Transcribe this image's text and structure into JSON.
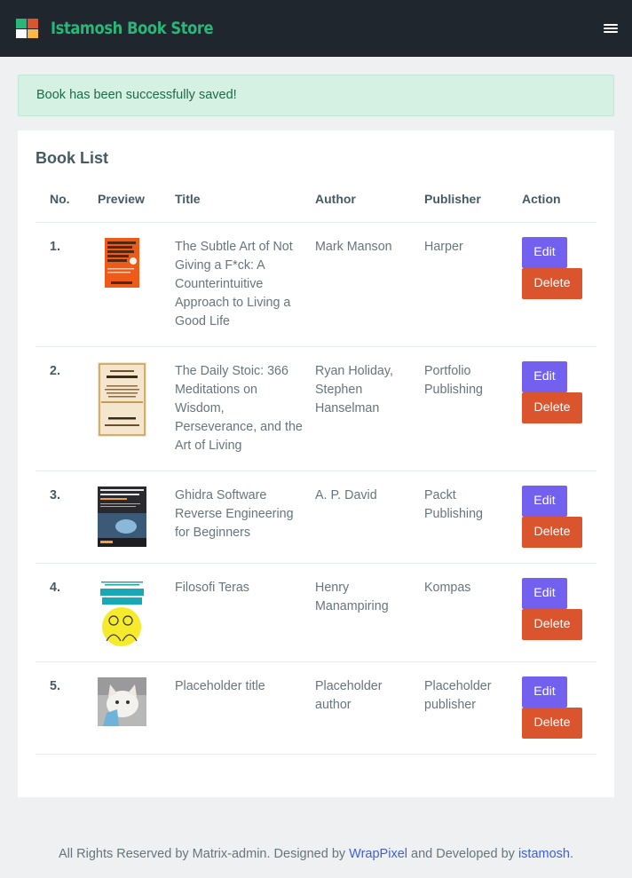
{
  "header": {
    "brand": "Istamosh Book Store",
    "menu_icon": "hamburger-menu-icon"
  },
  "alert": {
    "message": "Book has been successfully saved!"
  },
  "book_list": {
    "title": "Book List",
    "columns": [
      "No.",
      "Preview",
      "Title",
      "Author",
      "Publisher",
      "Action"
    ],
    "rows": [
      {
        "no": "1.",
        "title": "The Subtle Art of Not Giving a F*ck: A Counterintuitive Approach to Living a Good Life",
        "author": "Mark Manson",
        "publisher": "Harper",
        "edit": "Edit",
        "delete": "Delete",
        "preview": "book-cover-subtle-art"
      },
      {
        "no": "2.",
        "title": "The Daily Stoic: 366 Meditations on Wisdom, Perseverance, and the Art of Living",
        "author": "Ryan Holiday, Stephen Hanselman",
        "publisher": "Portfolio Publishing",
        "edit": "Edit",
        "delete": "Delete",
        "preview": "book-cover-daily-stoic"
      },
      {
        "no": "3.",
        "title": "Ghidra Software Reverse Engineering for Beginners",
        "author": "A. P. David",
        "publisher": "Packt Publishing",
        "edit": "Edit",
        "delete": "Delete",
        "preview": "book-cover-ghidra"
      },
      {
        "no": "4.",
        "title": "Filosofi Teras",
        "author": "Henry Manampiring",
        "publisher": "Kompas",
        "edit": "Edit",
        "delete": "Delete",
        "preview": "book-cover-filosofi-teras"
      },
      {
        "no": "5.",
        "title": "Placeholder title",
        "author": "Placeholder author",
        "publisher": "Placeholder publisher",
        "edit": "Edit",
        "delete": "Delete",
        "preview": "book-cover-placeholder-cat"
      }
    ]
  },
  "footer": {
    "prefix": "All Rights Reserved by Matrix-admin. Designed by",
    "link1": "WrapPixel",
    "middle": "and Developed by",
    "link2": "istamosh",
    "suffix": "."
  },
  "colors": {
    "topbar": "#1f262d",
    "brand": "#28b779",
    "edit_button": "#7460ee",
    "delete_button": "#da542e",
    "alert_bg": "#d4f1e4"
  }
}
